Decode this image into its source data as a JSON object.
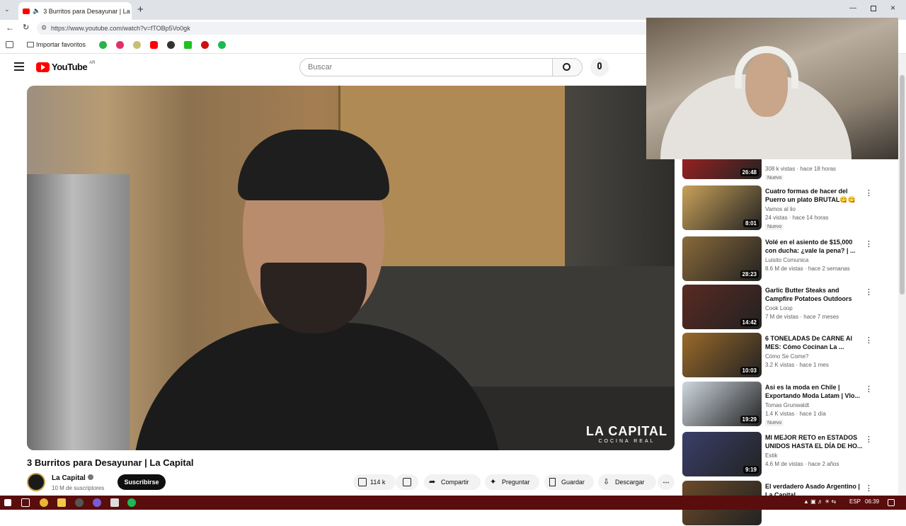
{
  "browser": {
    "tab_title": "3 Burritos para Desayunar | La",
    "url": "https://www.youtube.com/watch?v=fTOBp5Vo0gk",
    "bookmarks_label": "Importar favoritos"
  },
  "youtube": {
    "logo_text": "YouTube",
    "logo_region": "AR",
    "search_placeholder": "Buscar"
  },
  "video": {
    "watermark_line1": "LA CAPITAL",
    "watermark_line2": "COCINA REAL",
    "title": "3 Burritos para Desayunar | La Capital",
    "channel_name": "La Capital",
    "subscribers": "10 M de suscriptores",
    "subscribe_label": "Suscribirse",
    "likes": "114 k",
    "share_label": "Compartir",
    "ask_label": "Preguntar",
    "save_label": "Guardar",
    "download_label": "Descargar"
  },
  "recommendations": [
    {
      "title": "",
      "channel": "",
      "stats": "308 k vistas · hace 18 horas",
      "duration": "26:48",
      "badge": "Nuevo",
      "thumb_color": "#b22222"
    },
    {
      "title": "Cuatro formas de hacer del Puerro un plato BRUTAL😋😋",
      "channel": "Vamos al lio",
      "stats": "24 vistas · hace 14 horas",
      "duration": "8:01",
      "badge": "Nuevo",
      "thumb_color": "#c9a25a"
    },
    {
      "title": "Volé en el asiento de $15,000 con ducha: ¿vale la pena? | ...",
      "channel": "Luisito Comunica",
      "stats": "8.6 M de vistas · hace 2 semanas",
      "duration": "28:23",
      "badge": "",
      "thumb_color": "#8a6a3a"
    },
    {
      "title": "Garlic Butter Steaks and Campfire Potatoes Outdoors",
      "channel": "Cook Loop",
      "stats": "7 M de vistas · hace 7 meses",
      "duration": "14:42",
      "badge": "",
      "thumb_color": "#5a2a22"
    },
    {
      "title": "6 TONELADAS De CARNE Al MES: Cómo Cocinan La ...",
      "channel": "Cómo Se Come?",
      "stats": "3.2 K vistas · hace 1 mes",
      "duration": "10:03",
      "badge": "",
      "thumb_color": "#9a6a2a"
    },
    {
      "title": "Asi es la moda en Chile | Exportando Moda Latam | Vlo...",
      "channel": "Tomas Grunwaldt",
      "stats": "1.4 K vistas · hace 1 día",
      "duration": "19:29",
      "badge": "Nuevo",
      "thumb_color": "#cfd8e0"
    },
    {
      "title": "MI MEJOR RETO en ESTADOS UNIDOS HASTA EL DÍA DE HO...",
      "channel": "Estik",
      "stats": "4.6 M de vistas · hace 2 años",
      "duration": "9:19",
      "badge": "",
      "thumb_color": "#3a3f6a"
    },
    {
      "title": "El verdadero Asado Argentino | La Capital",
      "channel": "",
      "stats": "",
      "duration": "",
      "badge": "",
      "thumb_color": "#6a4a2a"
    }
  ],
  "taskbar": {
    "lang": "ESP",
    "time": "06:39"
  }
}
